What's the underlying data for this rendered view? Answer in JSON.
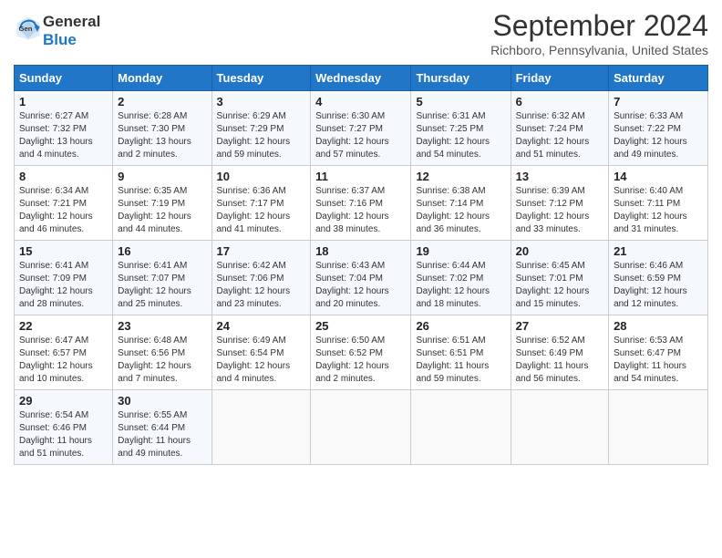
{
  "logo": {
    "line1": "General",
    "line2": "Blue"
  },
  "header": {
    "month": "September 2024",
    "location": "Richboro, Pennsylvania, United States"
  },
  "days_of_week": [
    "Sunday",
    "Monday",
    "Tuesday",
    "Wednesday",
    "Thursday",
    "Friday",
    "Saturday"
  ],
  "weeks": [
    [
      {
        "day": "1",
        "sunrise": "6:27 AM",
        "sunset": "7:32 PM",
        "daylight": "13 hours and 4 minutes."
      },
      {
        "day": "2",
        "sunrise": "6:28 AM",
        "sunset": "7:30 PM",
        "daylight": "13 hours and 2 minutes."
      },
      {
        "day": "3",
        "sunrise": "6:29 AM",
        "sunset": "7:29 PM",
        "daylight": "12 hours and 59 minutes."
      },
      {
        "day": "4",
        "sunrise": "6:30 AM",
        "sunset": "7:27 PM",
        "daylight": "12 hours and 57 minutes."
      },
      {
        "day": "5",
        "sunrise": "6:31 AM",
        "sunset": "7:25 PM",
        "daylight": "12 hours and 54 minutes."
      },
      {
        "day": "6",
        "sunrise": "6:32 AM",
        "sunset": "7:24 PM",
        "daylight": "12 hours and 51 minutes."
      },
      {
        "day": "7",
        "sunrise": "6:33 AM",
        "sunset": "7:22 PM",
        "daylight": "12 hours and 49 minutes."
      }
    ],
    [
      {
        "day": "8",
        "sunrise": "6:34 AM",
        "sunset": "7:21 PM",
        "daylight": "12 hours and 46 minutes."
      },
      {
        "day": "9",
        "sunrise": "6:35 AM",
        "sunset": "7:19 PM",
        "daylight": "12 hours and 44 minutes."
      },
      {
        "day": "10",
        "sunrise": "6:36 AM",
        "sunset": "7:17 PM",
        "daylight": "12 hours and 41 minutes."
      },
      {
        "day": "11",
        "sunrise": "6:37 AM",
        "sunset": "7:16 PM",
        "daylight": "12 hours and 38 minutes."
      },
      {
        "day": "12",
        "sunrise": "6:38 AM",
        "sunset": "7:14 PM",
        "daylight": "12 hours and 36 minutes."
      },
      {
        "day": "13",
        "sunrise": "6:39 AM",
        "sunset": "7:12 PM",
        "daylight": "12 hours and 33 minutes."
      },
      {
        "day": "14",
        "sunrise": "6:40 AM",
        "sunset": "7:11 PM",
        "daylight": "12 hours and 31 minutes."
      }
    ],
    [
      {
        "day": "15",
        "sunrise": "6:41 AM",
        "sunset": "7:09 PM",
        "daylight": "12 hours and 28 minutes."
      },
      {
        "day": "16",
        "sunrise": "6:41 AM",
        "sunset": "7:07 PM",
        "daylight": "12 hours and 25 minutes."
      },
      {
        "day": "17",
        "sunrise": "6:42 AM",
        "sunset": "7:06 PM",
        "daylight": "12 hours and 23 minutes."
      },
      {
        "day": "18",
        "sunrise": "6:43 AM",
        "sunset": "7:04 PM",
        "daylight": "12 hours and 20 minutes."
      },
      {
        "day": "19",
        "sunrise": "6:44 AM",
        "sunset": "7:02 PM",
        "daylight": "12 hours and 18 minutes."
      },
      {
        "day": "20",
        "sunrise": "6:45 AM",
        "sunset": "7:01 PM",
        "daylight": "12 hours and 15 minutes."
      },
      {
        "day": "21",
        "sunrise": "6:46 AM",
        "sunset": "6:59 PM",
        "daylight": "12 hours and 12 minutes."
      }
    ],
    [
      {
        "day": "22",
        "sunrise": "6:47 AM",
        "sunset": "6:57 PM",
        "daylight": "12 hours and 10 minutes."
      },
      {
        "day": "23",
        "sunrise": "6:48 AM",
        "sunset": "6:56 PM",
        "daylight": "12 hours and 7 minutes."
      },
      {
        "day": "24",
        "sunrise": "6:49 AM",
        "sunset": "6:54 PM",
        "daylight": "12 hours and 4 minutes."
      },
      {
        "day": "25",
        "sunrise": "6:50 AM",
        "sunset": "6:52 PM",
        "daylight": "12 hours and 2 minutes."
      },
      {
        "day": "26",
        "sunrise": "6:51 AM",
        "sunset": "6:51 PM",
        "daylight": "11 hours and 59 minutes."
      },
      {
        "day": "27",
        "sunrise": "6:52 AM",
        "sunset": "6:49 PM",
        "daylight": "11 hours and 56 minutes."
      },
      {
        "day": "28",
        "sunrise": "6:53 AM",
        "sunset": "6:47 PM",
        "daylight": "11 hours and 54 minutes."
      }
    ],
    [
      {
        "day": "29",
        "sunrise": "6:54 AM",
        "sunset": "6:46 PM",
        "daylight": "11 hours and 51 minutes."
      },
      {
        "day": "30",
        "sunrise": "6:55 AM",
        "sunset": "6:44 PM",
        "daylight": "11 hours and 49 minutes."
      },
      null,
      null,
      null,
      null,
      null
    ]
  ],
  "labels": {
    "sunrise": "Sunrise:",
    "sunset": "Sunset:",
    "daylight": "Daylight:"
  }
}
